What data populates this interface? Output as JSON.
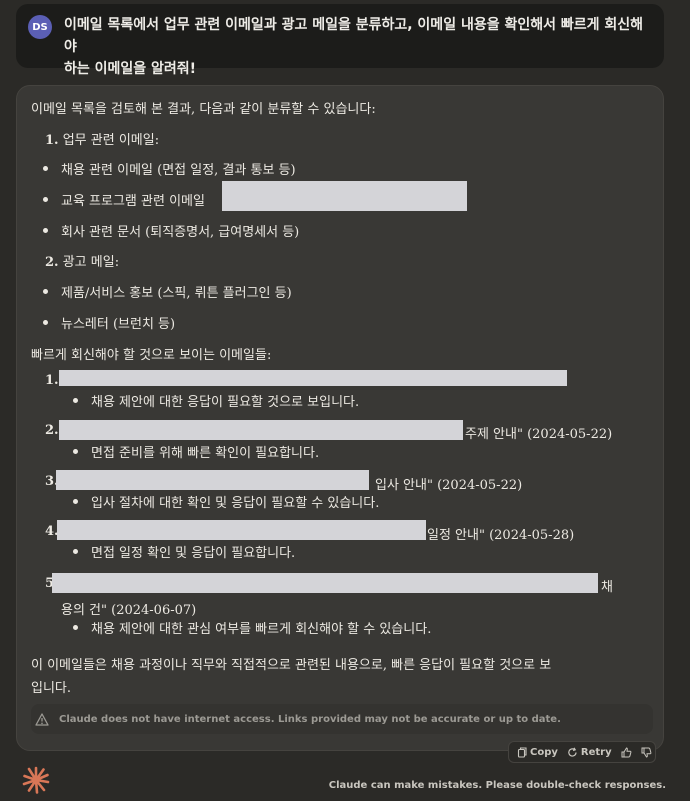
{
  "user": {
    "avatar_initials": "DS",
    "message_line1": "이메일 목록에서 업무 관련 이메일과 광고 메일을 분류하고, 이메일 내용을 확인해서 빠르게 회신해야",
    "message_line2": "하는 이메일을 알려줘!"
  },
  "response": {
    "intro": "이메일 목록을 검토해 본 결과, 다음과 같이 분류할 수 있습니다:",
    "work_heading_num": "1.",
    "work_heading": "업무 관련 이메일:",
    "work_items": [
      "채용 관련 이메일 (면접 일정, 결과 통보 등)",
      "교육 프로그램 관련 이메일",
      "회사 관련 문서 (퇴직증명서, 급여명세서 등)"
    ],
    "ad_heading_num": "2.",
    "ad_heading": "광고 메일:",
    "ad_items": [
      "제품/서비스 홍보 (스픽, 뤼튼 플러그인 등)",
      "뉴스레터 (브런치 등)"
    ],
    "urgent_heading": "빠르게 회신해야 할 것으로 보이는 이메일들:",
    "urgent": [
      {
        "num": "1.",
        "title_suffix": "",
        "note": "채용 제안에 대한 응답이 필요할 것으로 보입니다."
      },
      {
        "num": "2.",
        "title_suffix": "주제 안내\" (2024-05-22)",
        "note": "면접 준비를 위해 빠른 확인이 필요합니다."
      },
      {
        "num": "3.",
        "title_suffix": "입사 안내\" (2024-05-22)",
        "note": "입사 절차에 대한 확인 및 응답이 필요할 수 있습니다."
      },
      {
        "num": "4.",
        "title_suffix": "일정 안내\" (2024-05-28)",
        "note": "면접 일정 확인 및 응답이 필요합니다."
      },
      {
        "num": "5",
        "title_suffix": "채",
        "title_line2": "용의 건\" (2024-06-07)",
        "note": "채용 제안에 대한 관심 여부를 빠르게 회신해야 할 수 있습니다."
      }
    ],
    "conclusion_line1": "이 이메일들은 채용 과정이나 직무와 직접적으로 관련된 내용으로, 빠른 응답이 필요할 것으로 보",
    "conclusion_line2": "입니다.",
    "warning": "Claude does not have internet access. Links provided may not be accurate or up to date."
  },
  "actions": {
    "copy_label": "Copy",
    "retry_label": "Retry"
  },
  "footer": {
    "disclaimer": "Claude can make mistakes. Please double-check responses."
  },
  "colors": {
    "background": "#2b2a27",
    "bubble": "#1c1c1a",
    "response_card": "#393835",
    "avatar": "#5b5fb5",
    "logo": "#d97757",
    "redaction": "#d4d4d8"
  }
}
